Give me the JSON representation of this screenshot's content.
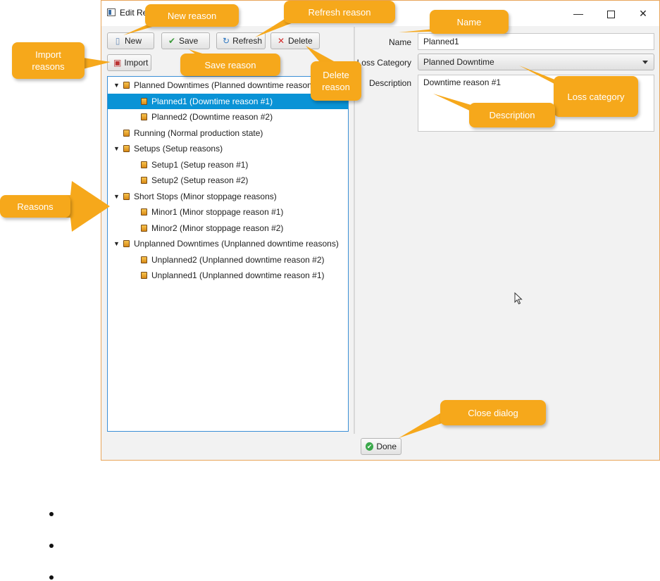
{
  "window": {
    "title": "Edit Reasons",
    "controls": {
      "minimize": "—",
      "maximize": "",
      "close": "✕"
    }
  },
  "toolbar": {
    "new_label": "New",
    "save_label": "Save",
    "refresh_label": "Refresh",
    "delete_label": "Delete",
    "import_label": "Import"
  },
  "tree": {
    "rows": [
      {
        "label": "Planned Downtimes (Planned downtime reasons)",
        "level": 0,
        "expandable": true,
        "selected": false
      },
      {
        "label": "Planned1 (Downtime reason #1)",
        "level": 1,
        "expandable": false,
        "selected": true
      },
      {
        "label": "Planned2 (Downtime reason #2)",
        "level": 1,
        "expandable": false,
        "selected": false
      },
      {
        "label": "Running (Normal production state)",
        "level": 0,
        "expandable": false,
        "selected": false
      },
      {
        "label": "Setups (Setup reasons)",
        "level": 0,
        "expandable": true,
        "selected": false
      },
      {
        "label": "Setup1 (Setup reason #1)",
        "level": 1,
        "expandable": false,
        "selected": false
      },
      {
        "label": "Setup2 (Setup reason #2)",
        "level": 1,
        "expandable": false,
        "selected": false
      },
      {
        "label": "Short Stops (Minor stoppage reasons)",
        "level": 0,
        "expandable": true,
        "selected": false
      },
      {
        "label": "Minor1 (Minor stoppage reason #1)",
        "level": 1,
        "expandable": false,
        "selected": false
      },
      {
        "label": "Minor2 (Minor stoppage reason #2)",
        "level": 1,
        "expandable": false,
        "selected": false
      },
      {
        "label": "Unplanned Downtimes (Unplanned downtime reasons)",
        "level": 0,
        "expandable": true,
        "selected": false
      },
      {
        "label": "Unplanned2 (Unplanned downtime  reason #2)",
        "level": 1,
        "expandable": false,
        "selected": false
      },
      {
        "label": "Unplanned1 (Unplanned downtime reason #1)",
        "level": 1,
        "expandable": false,
        "selected": false
      }
    ]
  },
  "form": {
    "name_label": "Name",
    "name_value": "Planned1",
    "loss_category_label": "Loss Category",
    "loss_category_value": "Planned Downtime",
    "description_label": "Description",
    "description_value": "Downtime reason #1"
  },
  "footer": {
    "done_label": "Done"
  },
  "callouts": {
    "new_reason": "New reason",
    "refresh_reason": "Refresh reason",
    "name": "Name",
    "import_reasons": "Import reasons",
    "save_reason": "Save reason",
    "delete_reason": "Delete reason",
    "loss_category": "Loss category",
    "description": "Description",
    "reasons": "Reasons",
    "close_dialog": "Close dialog"
  },
  "colors": {
    "callout": "#f6a81b",
    "selection": "#0a93d6",
    "tree_border": "#3b8fd6"
  }
}
